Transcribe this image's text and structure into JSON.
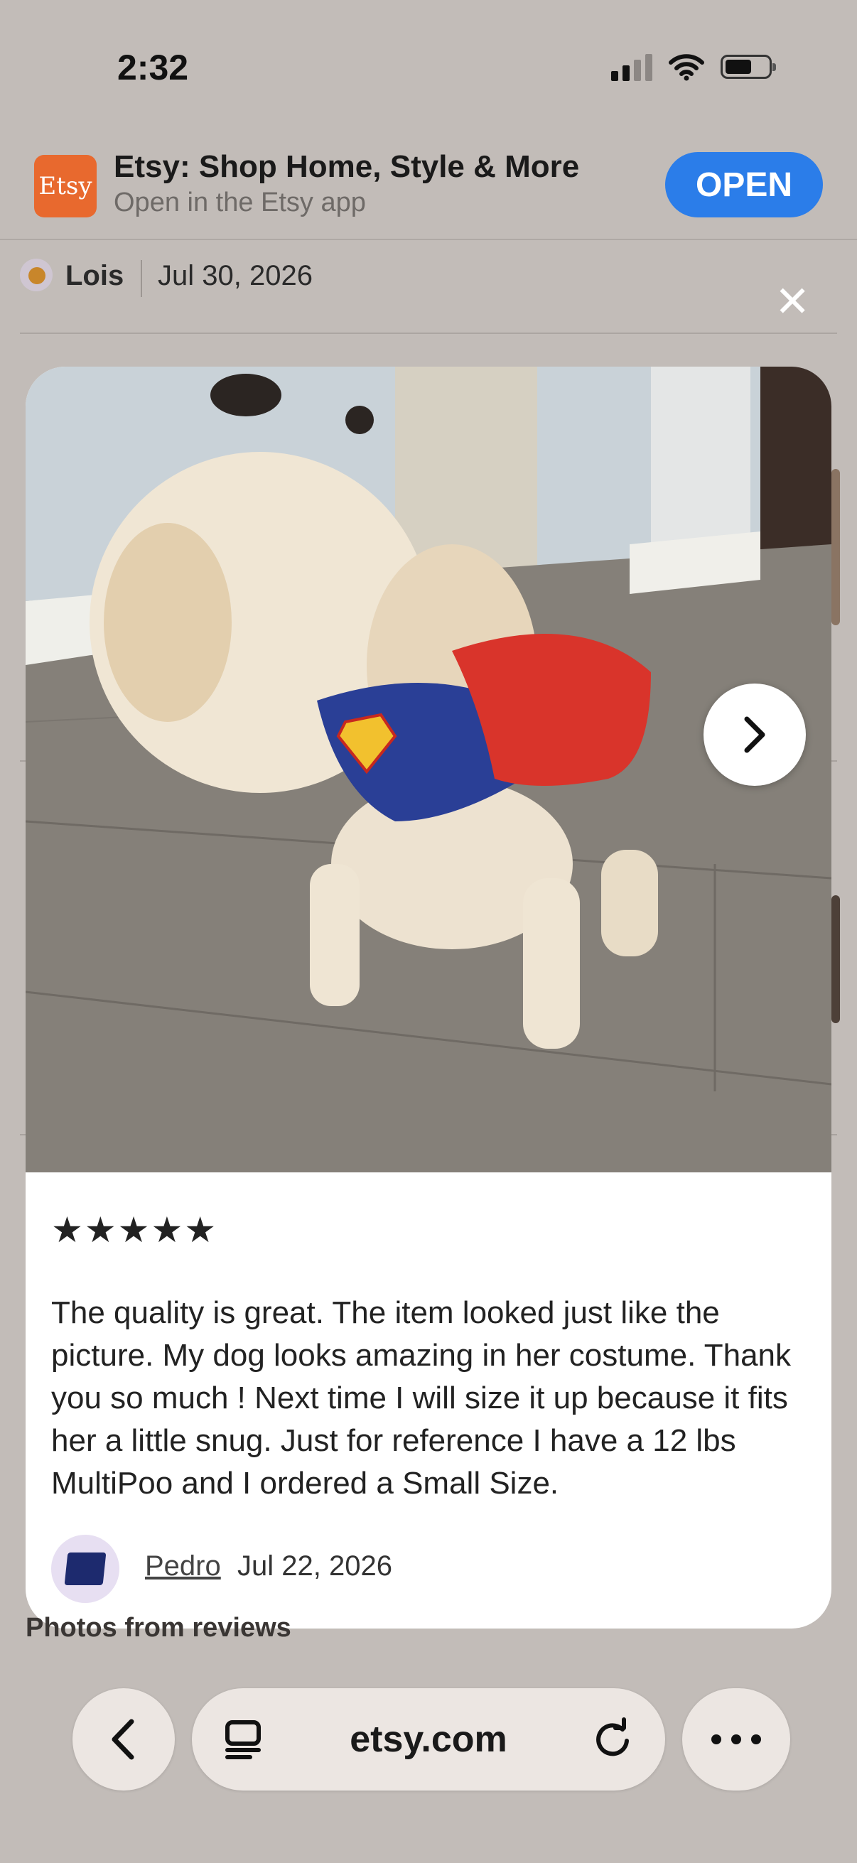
{
  "status_bar": {
    "time": "2:32"
  },
  "app_banner": {
    "logo_text": "Etsy",
    "title": "Etsy: Shop Home, Style & More",
    "subtitle": "Open in the Etsy app",
    "open_label": "OPEN"
  },
  "background_review": {
    "author": "Lois",
    "date": "Jul 30, 2026"
  },
  "review_modal": {
    "stars": "★★★★★",
    "rating": 5,
    "text": "The quality is great. The item looked just like the picture. My dog looks amazing in her costume. Thank you so much ! Next time I will size it up because it fits her a little snug. Just for reference I have a 12 lbs MultiPoo and I ordered a Small Size.",
    "reviewer": "Pedro",
    "date": "Jul 22, 2026"
  },
  "section_label": "Photos from reviews",
  "browser": {
    "url": "etsy.com"
  },
  "colors": {
    "accent": "#2b7de9",
    "etsy_orange": "#e8692e"
  }
}
